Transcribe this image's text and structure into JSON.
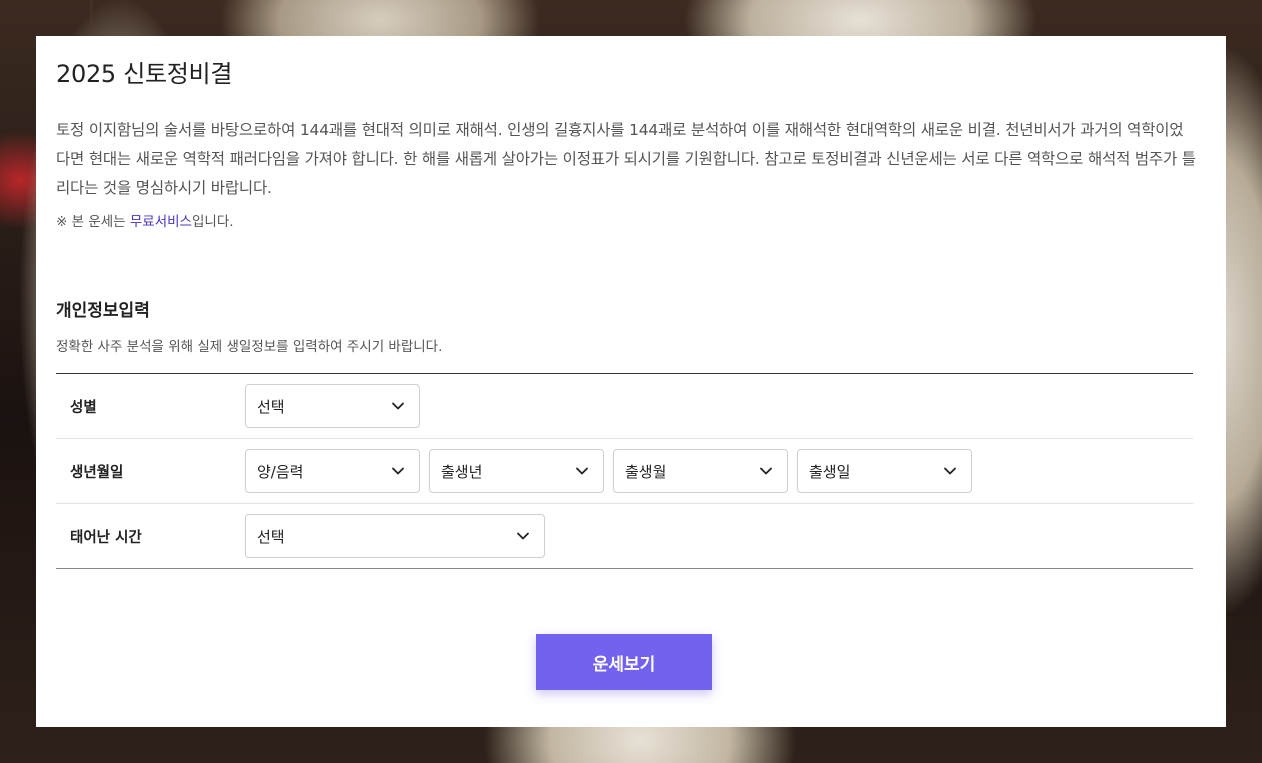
{
  "page": {
    "title": "2025 신토정비결",
    "intro": "토정 이지함님의 술서를 바탕으로하여 144괘를 현대적 의미로 재해석. 인생의 길흉지사를 144괘로 분석하여 이를 재해석한 현대역학의 새로운 비결. 천년비서가 과거의 역학이었다면 현대는 새로운 역학적 패러다임을 가져야 합니다. 한 해를 새롭게 살아가는 이정표가 되시기를 기원합니다. 참고로 토정비결과 신년운세는 서로 다른 역학으로 해석적 범주가 틀리다는 것을 명심하시기 바랍니다.",
    "note_prefix": "※ 본 운세는 ",
    "note_free": "무료서비스",
    "note_suffix": "입니다."
  },
  "form": {
    "section_title": "개인정보입력",
    "section_desc": "정확한 사주 분석을 위해 실제 생일정보를 입력하여 주시기 바랍니다.",
    "gender": {
      "label": "성별",
      "value": "선택"
    },
    "birth": {
      "label": "생년월일",
      "calendar": "양/음력",
      "year": "출생년",
      "month": "출생월",
      "day": "출생일"
    },
    "time": {
      "label": "태어난 시간",
      "value": "선택"
    },
    "submit_label": "운세보기"
  },
  "colors": {
    "accent": "#7262ef",
    "free_service": "#4b33c2"
  },
  "icons": {
    "dropdown": "chevron-down-icon"
  }
}
